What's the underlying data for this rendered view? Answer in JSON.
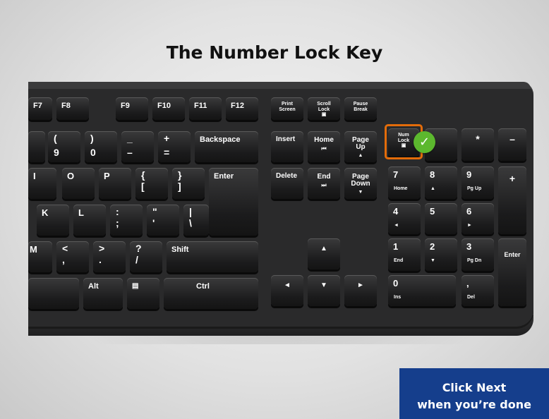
{
  "title": "The Number Lock Key",
  "next_button": {
    "line1": "Click Next",
    "line2": "when you’re done"
  },
  "keys": {
    "f7": "F7",
    "f8": "F8",
    "f9": "F9",
    "f10": "F10",
    "f11": "F11",
    "f12": "F12",
    "print_screen": {
      "l1": "Print",
      "l2": "Screen"
    },
    "scroll_lock": {
      "l1": "Scroll",
      "l2": "Lock"
    },
    "pause": {
      "l1": "Pause",
      "l2": "Break"
    },
    "num_lock": {
      "l1": "Num",
      "l2": "Lock"
    },
    "nine": {
      "top": "(",
      "bottom": "9"
    },
    "zero": {
      "top": ")",
      "bottom": "0"
    },
    "minus": {
      "top": "_",
      "bottom": "–"
    },
    "equals": {
      "top": "+",
      "bottom": "="
    },
    "backspace": "Backspace",
    "insert": "Insert",
    "home": "Home",
    "page_up": {
      "l1": "Page",
      "l2": "Up"
    },
    "i": "I",
    "o": "O",
    "p": "P",
    "lbracket": {
      "top": "{",
      "bottom": "["
    },
    "rbracket": {
      "top": "}",
      "bottom": "]"
    },
    "enter": "Enter",
    "delete": "Delete",
    "end": "End",
    "page_down": {
      "l1": "Page",
      "l2": "Down"
    },
    "k": "K",
    "l": "L",
    "semicolon": {
      "top": ":",
      "bottom": ";"
    },
    "quote": {
      "top": "\"",
      "bottom": "'"
    },
    "backslash": {
      "top": "|",
      "bottom": "\\"
    },
    "m": "M",
    "comma": {
      "top": "<",
      "bottom": ","
    },
    "period": {
      "top": ">",
      "bottom": "."
    },
    "slash": {
      "top": "?",
      "bottom": "/"
    },
    "shift": "Shift",
    "alt": "Alt",
    "ctrl": "Ctrl",
    "numpad": {
      "star": "*",
      "minus": "–",
      "plus": "+",
      "enter": "Enter",
      "n7": {
        "main": "7",
        "sub": "Home"
      },
      "n8": {
        "main": "8",
        "sub": "▲"
      },
      "n9": {
        "main": "9",
        "sub": "Pg Up"
      },
      "n4": {
        "main": "4",
        "sub": "◄"
      },
      "n5": {
        "main": "5",
        "sub": ""
      },
      "n6": {
        "main": "6",
        "sub": "►"
      },
      "n1": {
        "main": "1",
        "sub": "End"
      },
      "n2": {
        "main": "2",
        "sub": "▼"
      },
      "n3": {
        "main": "3",
        "sub": "Pg Dn"
      },
      "n0": {
        "main": "0",
        "sub": "Ins"
      },
      "dot": {
        "main": ",",
        "sub": "Del"
      }
    }
  },
  "colors": {
    "highlight": "#e36c0a",
    "check": "#5cb82e",
    "next_button": "#153e8c"
  }
}
